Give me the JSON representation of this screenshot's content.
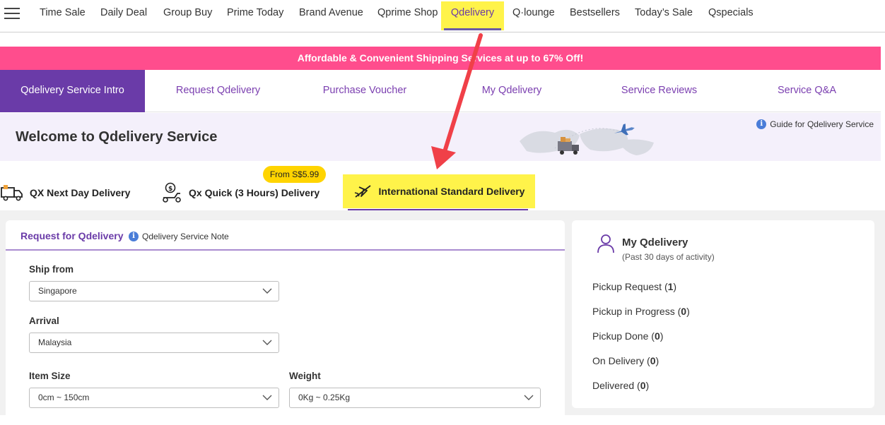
{
  "topnav": {
    "items": [
      "Time Sale",
      "Daily Deal",
      "Group Buy",
      "Prime Today",
      "Brand Avenue",
      "Qprime Shop",
      "Qdelivery",
      "Q·lounge",
      "Bestsellers",
      "Today’s Sale",
      "Qspecials"
    ],
    "active": "Qdelivery"
  },
  "promo": {
    "text": "Affordable & Convenient Shipping Services at up to 67% Off!"
  },
  "subnav": {
    "tabs": [
      "Qdelivery Service Intro",
      "Request Qdelivery",
      "Purchase Voucher",
      "My Qdelivery",
      "Service Reviews",
      "Service Q&A"
    ],
    "active": "Qdelivery Service Intro"
  },
  "welcome": {
    "title": "Welcome to Qdelivery Service",
    "guide_link": "Guide for Qdelivery Service"
  },
  "delivery_tabs": {
    "tabs": [
      "QX Next Day Delivery",
      "Qx Quick (3 Hours) Delivery",
      "International Standard Delivery"
    ],
    "active": "International Standard Delivery",
    "price_badge": "From S$5.99"
  },
  "request": {
    "title": "Request for Qdelivery",
    "note_link": "Qdelivery Service Note",
    "ship_from_label": "Ship from",
    "ship_from_value": "Singapore",
    "arrival_label": "Arrival",
    "arrival_value": "Malaysia",
    "item_size_label": "Item Size",
    "item_size_value": "0cm ~ 150cm",
    "weight_label": "Weight",
    "weight_value": "0Kg ~ 0.25Kg"
  },
  "my_qdelivery": {
    "title": "My Qdelivery",
    "subtitle": "(Past 30 days of activity)",
    "stats": [
      {
        "label": "Pickup Request",
        "count": "1"
      },
      {
        "label": "Pickup in Progress",
        "count": "0"
      },
      {
        "label": "Pickup Done",
        "count": "0"
      },
      {
        "label": "On Delivery",
        "count": "0"
      },
      {
        "label": "Delivered",
        "count": "0"
      }
    ]
  },
  "colors": {
    "accent_purple": "#6a3ba8",
    "promo_pink": "#ff4d8d",
    "highlight_yellow": "#fff34a",
    "badge_yellow": "#ffd400",
    "annotation_red": "#f04048"
  }
}
